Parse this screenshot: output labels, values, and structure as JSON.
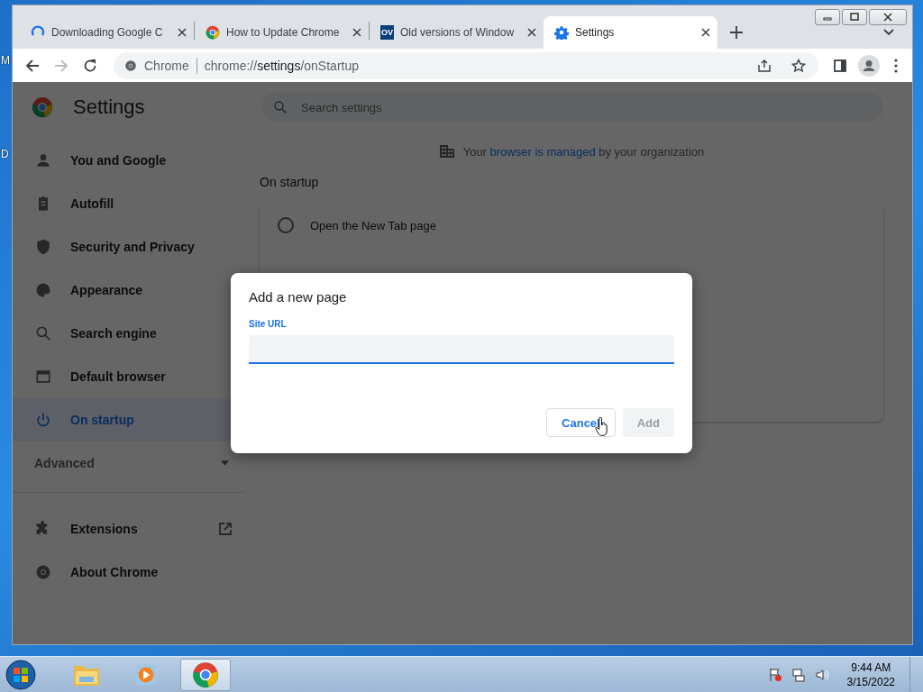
{
  "desktop": {
    "edge_labels": [
      "M",
      "D"
    ]
  },
  "tabs": [
    {
      "title": "Downloading Google C",
      "kind": "spinner",
      "selected": false
    },
    {
      "title": "How to Update Chrome",
      "kind": "chrome",
      "selected": false
    },
    {
      "title": "Old versions of Window",
      "kind": "badge",
      "badge_text": "OV",
      "selected": false
    },
    {
      "title": "Settings",
      "kind": "gear",
      "selected": true
    }
  ],
  "toolbar": {
    "site_chip": "Chrome",
    "url": "chrome://**settings**/onStartup",
    "forward_disabled": true
  },
  "settings": {
    "title": "Settings",
    "search": {
      "placeholder": "Search settings"
    },
    "sidebar": {
      "items": [
        {
          "label": "You and Google",
          "kind": "person",
          "selected": false
        },
        {
          "label": "Autofill",
          "kind": "clipboard",
          "selected": false
        },
        {
          "label": "Security and Privacy",
          "kind": "shield",
          "selected": false
        },
        {
          "label": "Appearance",
          "kind": "palette",
          "selected": false
        },
        {
          "label": "Search engine",
          "kind": "search",
          "selected": false
        },
        {
          "label": "Default browser",
          "kind": "browser",
          "selected": false
        },
        {
          "label": "On startup",
          "kind": "power",
          "selected": true
        }
      ],
      "advanced": {
        "label": "Advanced",
        "expanded": false
      },
      "footer_items": [
        {
          "label": "Extensions",
          "kind": "puzzle",
          "external": true
        },
        {
          "label": "About Chrome",
          "kind": "chrome",
          "external": false
        }
      ]
    },
    "managed_notice": {
      "before": "Your ",
      "link": "browser is managed",
      "after": " by your organization"
    },
    "section_title": "On startup",
    "startup_options": [
      {
        "label": "Open the New Tab page",
        "selected": false
      }
    ]
  },
  "dialog": {
    "title": "Add a new page",
    "field": {
      "label": "Site URL",
      "focused": true
    },
    "buttons": [
      {
        "label": "Cancel",
        "kind": "secondary",
        "disabled": false
      },
      {
        "label": "Add",
        "kind": "primary",
        "disabled": true
      }
    ]
  },
  "taskbar": {
    "apps": [
      {
        "kind": "folder",
        "active": false
      },
      {
        "kind": "media",
        "active": false
      },
      {
        "kind": "chrome",
        "active": true
      }
    ],
    "clock": {
      "time": "9:44 AM",
      "date": "3/15/2022"
    }
  }
}
